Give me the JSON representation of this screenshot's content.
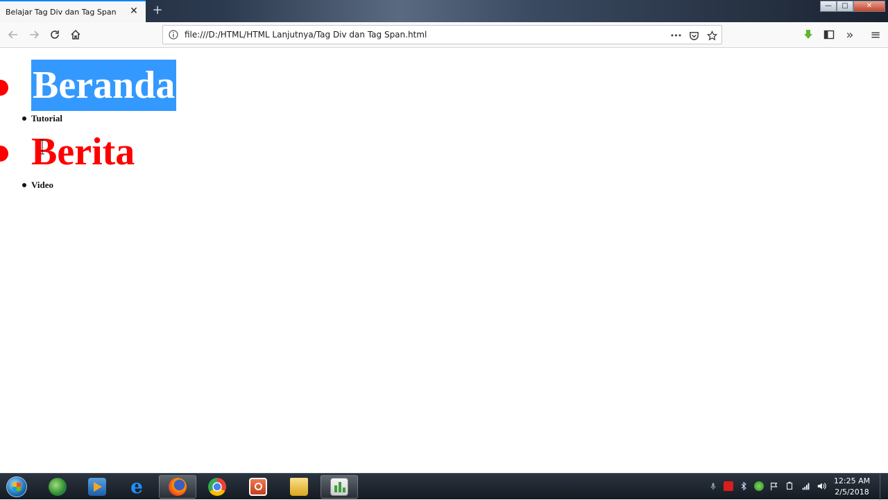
{
  "browser": {
    "tab_title": "Belajar Tag Div dan Tag Span",
    "tab_close_glyph": "✕",
    "new_tab_glyph": "+",
    "window_controls": {
      "minimize": "—",
      "maximize": "□",
      "close": "✕"
    },
    "url": "file:///D:/HTML/HTML Lanjutnya/Tag Div dan Tag Span.html",
    "page_actions_glyph": "•••",
    "overflow_glyph": "»",
    "menu_glyph": "≡"
  },
  "page": {
    "items": [
      {
        "label": "Beranda",
        "style": "big",
        "selected": true
      },
      {
        "label": "Tutorial",
        "style": "small"
      },
      {
        "label": "Berita",
        "style": "big"
      },
      {
        "label": "Video",
        "style": "small"
      }
    ]
  },
  "taskbar": {
    "apps": [
      {
        "icon": "internet-download-manager-icon",
        "color": "#2e8b2e"
      },
      {
        "icon": "media-player-icon",
        "color": "#e8862a"
      },
      {
        "icon": "internet-explorer-icon",
        "color": "#1e90ff"
      },
      {
        "icon": "firefox-icon",
        "color": "#ff6a00",
        "active": true
      },
      {
        "icon": "chrome-icon",
        "color": "#34a853"
      },
      {
        "icon": "powerpoint-icon",
        "color": "#d24726"
      },
      {
        "icon": "file-explorer-icon",
        "color": "#f0c040"
      },
      {
        "icon": "notepad-icon",
        "color": "#6bbf3a"
      }
    ],
    "clock": {
      "time": "12:25 AM",
      "date": "2/5/2018"
    }
  },
  "colors": {
    "accent": "#0a84ff",
    "selection": "#3399ff",
    "heading_red": "#ff0000"
  }
}
